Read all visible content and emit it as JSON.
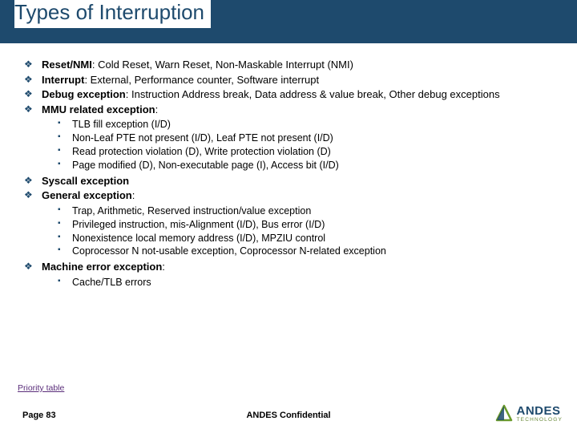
{
  "title": "Types of Interruption",
  "bullets": [
    {
      "bold": "Reset/NMI",
      "rest": ": Cold Reset, Warn Reset, Non-Maskable Interrupt (NMI)"
    },
    {
      "bold": "Interrupt",
      "rest": ": External, Performance counter, Software interrupt"
    },
    {
      "bold": "Debug exception",
      "rest": ": Instruction Address break, Data address & value break, Other debug exceptions"
    },
    {
      "bold": "MMU related exception",
      "rest": ":",
      "sub": [
        "TLB fill exception (I/D)",
        "Non-Leaf PTE not present (I/D), Leaf PTE not present (I/D)",
        "Read protection violation (D), Write protection violation (D)",
        "Page modified (D), Non-executable page (I), Access bit (I/D)"
      ]
    },
    {
      "bold": "Syscall exception",
      "rest": ""
    },
    {
      "bold": "General exception",
      "rest": ":",
      "sub": [
        "Trap, Arithmetic, Reserved instruction/value exception",
        "Privileged instruction, mis-Alignment (I/D), Bus error (I/D)",
        "Nonexistence local memory address (I/D), MPZIU control",
        "Coprocessor N not-usable exception, Coprocessor N-related exception"
      ]
    },
    {
      "bold": "Machine error exception",
      "rest": ":",
      "sub": [
        "Cache/TLB errors"
      ]
    }
  ],
  "link": "Priority table",
  "page": "Page 83",
  "confidential": "ANDES Confidential",
  "logo": {
    "brand": "ANDES",
    "sub": "TECHNOLOGY"
  }
}
